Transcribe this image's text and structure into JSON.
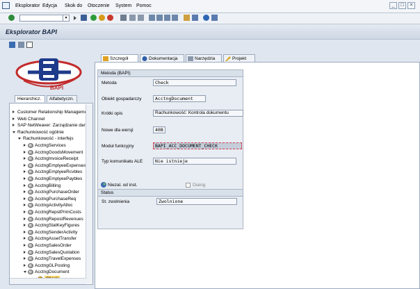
{
  "menu": {
    "items": [
      "Eksplorator",
      "Edycja",
      "Skok do",
      "Otoczenie",
      "System",
      "Pomoc"
    ]
  },
  "window": {
    "title": "Eksplorator BAPI"
  },
  "logo": {
    "text": "BAPI"
  },
  "nav_tabs": [
    "Hierarchicz.",
    "Alfabetyczn."
  ],
  "tree": [
    {
      "label": "Customer Relationship Managemen",
      "level": 0,
      "type": "tri-right"
    },
    {
      "label": "Web Channel",
      "level": 0,
      "type": "tri-right"
    },
    {
      "label": "SAP NetWeaver: Zarządzanie dany",
      "level": 0,
      "type": "tri-right"
    },
    {
      "label": "Rachunkowość ogólnie",
      "level": 0,
      "type": "tri-down"
    },
    {
      "label": "Rachunkowość - interfejs",
      "level": 1,
      "type": "tri-down"
    },
    {
      "label": "AcctngServices",
      "level": 2,
      "type": "node"
    },
    {
      "label": "AcctngGoodsMovement",
      "level": 2,
      "type": "node"
    },
    {
      "label": "AcctngInvoiceReceipt",
      "level": 2,
      "type": "node"
    },
    {
      "label": "AcctngEmplyeeExpenses",
      "level": 2,
      "type": "node"
    },
    {
      "label": "AcctngEmplyeeRcvbles",
      "level": 2,
      "type": "node"
    },
    {
      "label": "AcctngEmplyeePaybles",
      "level": 2,
      "type": "node"
    },
    {
      "label": "AcctngBilling",
      "level": 2,
      "type": "node"
    },
    {
      "label": "AcctngPurchaseOrder",
      "level": 2,
      "type": "node"
    },
    {
      "label": "AcctngPurchaseReq",
      "level": 2,
      "type": "node"
    },
    {
      "label": "AcctngActivityAlloc",
      "level": 2,
      "type": "node"
    },
    {
      "label": "AcctngRepstPrimCosts",
      "level": 2,
      "type": "node"
    },
    {
      "label": "AcctngRepostRevenues",
      "level": 2,
      "type": "node"
    },
    {
      "label": "AcctngStatKeyFigures",
      "level": 2,
      "type": "node"
    },
    {
      "label": "AcctngSenderActivity",
      "level": 2,
      "type": "node"
    },
    {
      "label": "AcctngAssetTransfer",
      "level": 2,
      "type": "node"
    },
    {
      "label": "AcctngSalesOrder",
      "level": 2,
      "type": "node"
    },
    {
      "label": "AcctngSalesQuotation",
      "level": 2,
      "type": "node"
    },
    {
      "label": "AcctngTravelExpenses",
      "level": 2,
      "type": "node"
    },
    {
      "label": "AcctngGLPosting",
      "level": 2,
      "type": "node"
    },
    {
      "label": "AcctngDocument",
      "level": 2,
      "type": "node-open"
    },
    {
      "label": "Check",
      "level": 3,
      "type": "method-selected"
    }
  ],
  "detail_tabs": [
    "Szczegół",
    "Dokumentacja",
    "Narzędzia",
    "Projekt"
  ],
  "method_group": {
    "title": "Metoda (BAPI)",
    "fields": [
      {
        "label": "Metoda",
        "value": "Check",
        "style": "mono"
      },
      {
        "label": "Obiekt gospadarczy",
        "value": "AcctngDocument",
        "style": "mono"
      },
      {
        "label": "Krótki opis",
        "value": "Rachunkowość: Kontrola dokumentu",
        "style": "plain"
      },
      {
        "label": "Nowe dla wersji",
        "value": "40B",
        "style": "mono"
      },
      {
        "label": "Moduł funkcyjny",
        "value": "BAPI_ACC_DOCUMENT_CHECK",
        "style": "hl"
      },
      {
        "label": "Typ komunikatu ALE",
        "value": "Nie istnieje",
        "style": "mono"
      }
    ],
    "niezal_label": "Niezal. od inst.",
    "dialog_label": "Dialog"
  },
  "status_group": {
    "title": "Status",
    "label": "St. zwolnienia",
    "value": "Zwolnione"
  }
}
